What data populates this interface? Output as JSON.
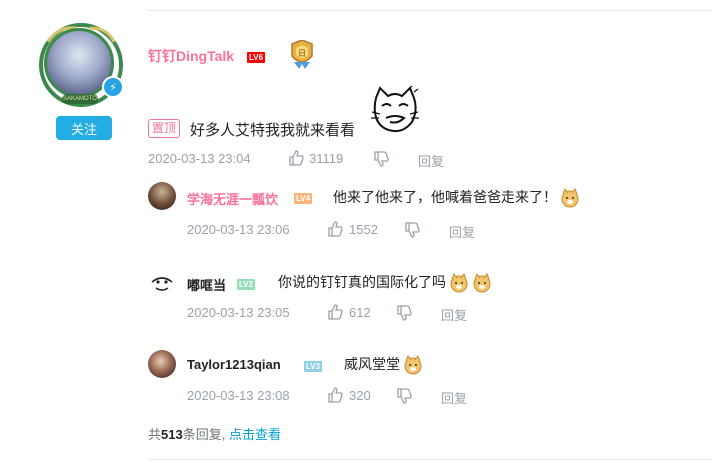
{
  "main_comment": {
    "username": "钉钉DingTalk",
    "level": "LV6",
    "follow_label": "关注",
    "pin_label": "置顶",
    "text": "好多人艾特我我就来看看",
    "time": "2020-03-13 23:04",
    "likes": "31119",
    "reply_label": "回复",
    "avatar_ring_text": "SAKAMOTO"
  },
  "replies": [
    {
      "username": "学海无涯一瓢饮",
      "level": "LV4",
      "text": "他来了他来了，他喊着爸爸走来了！",
      "time": "2020-03-13 23:06",
      "likes": "1552",
      "reply_label": "回复",
      "name_color": "#fb7299"
    },
    {
      "username": "嘟哐当",
      "level": "LV2",
      "text": "你说的钉钉真的国际化了吗",
      "time": "2020-03-13 23:05",
      "likes": "612",
      "reply_label": "回复",
      "name_color": "#222222"
    },
    {
      "username": "Taylor1213qian",
      "level": "LV3",
      "text": "威风堂堂",
      "time": "2020-03-13 23:08",
      "likes": "320",
      "reply_label": "回复",
      "name_color": "#222222"
    }
  ],
  "summary": {
    "prefix": "共",
    "count": "513",
    "suffix": "条回复,",
    "view_label": "点击查看"
  },
  "colors": {
    "accent_pink": "#fb7299",
    "link_blue": "#00a1d6",
    "follow_blue": "#23ade5",
    "meta_gray": "#99a2aa"
  }
}
